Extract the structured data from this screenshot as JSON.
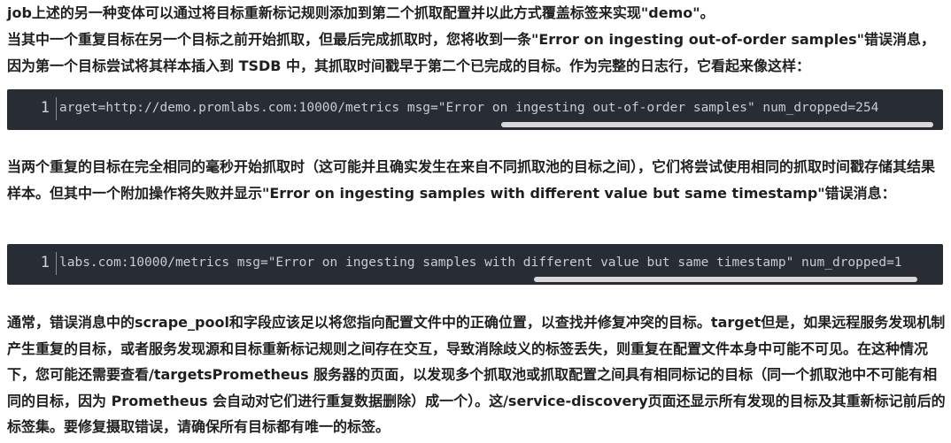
{
  "paragraphs": {
    "p1": "job上述的另一种变体可以通过将目标重新标记规则添加到第二个抓取配置并以此方式覆盖标签来实现\"demo\"。",
    "p2": "当其中一个重复目标在另一个目标之前开始抓取，但最后完成抓取时，您将收到一条\"Error on ingesting out-of-order samples\"错误消息，因为第一个目标尝试将其样本插入到 TSDB 中，其抓取时间戳早于第二个已完成的目标。作为完整的日志行，它看起来像这样：",
    "p3": "当两个重复的目标在完全相同的毫秒开始抓取时（这可能并且确实发生在来自不同抓取池的目标之间），它们将尝试使用相同的抓取时间戳存储其结果样本。但其中一个附加操作将失败并显示\"Error on ingesting samples with different value but same timestamp\"错误消息：",
    "p4": "通常，错误消息中的scrape_pool和字段应该足以将您指向配置文件中的正确位置，以查找并修复冲突的目标。target但是，如果远程服务发现机制产生重复的目标，或者服务发现源和目标重新标记规则之间存在交互，导致消除歧义的标签丢失，则重复在配置文件本身中可能不可见。在这种情况下，您可能还需要查看/targetsPrometheus 服务器的页面，以发现多个抓取池或抓取配置之间具有相同标记的目标（同一个抓取池中不可能有相同的目标，因为 Prometheus 会自动对它们进行重复数据删除）成一个）。这/service-discovery页面还显示所有发现的目标及其重新标记前后的标签集。要修复摄取错误，请确保所有目标都有唯一的标签。"
  },
  "code_blocks": {
    "block1": {
      "line_number": "1",
      "text": "arget=http://demo.promlabs.com:10000/metrics msg=\"Error on ingesting out-of-order samples\" num_dropped=254"
    },
    "block2": {
      "line_number": "1",
      "text": "labs.com:10000/metrics msg=\"Error on ingesting samples with different value but same timestamp\" num_dropped=1"
    }
  }
}
